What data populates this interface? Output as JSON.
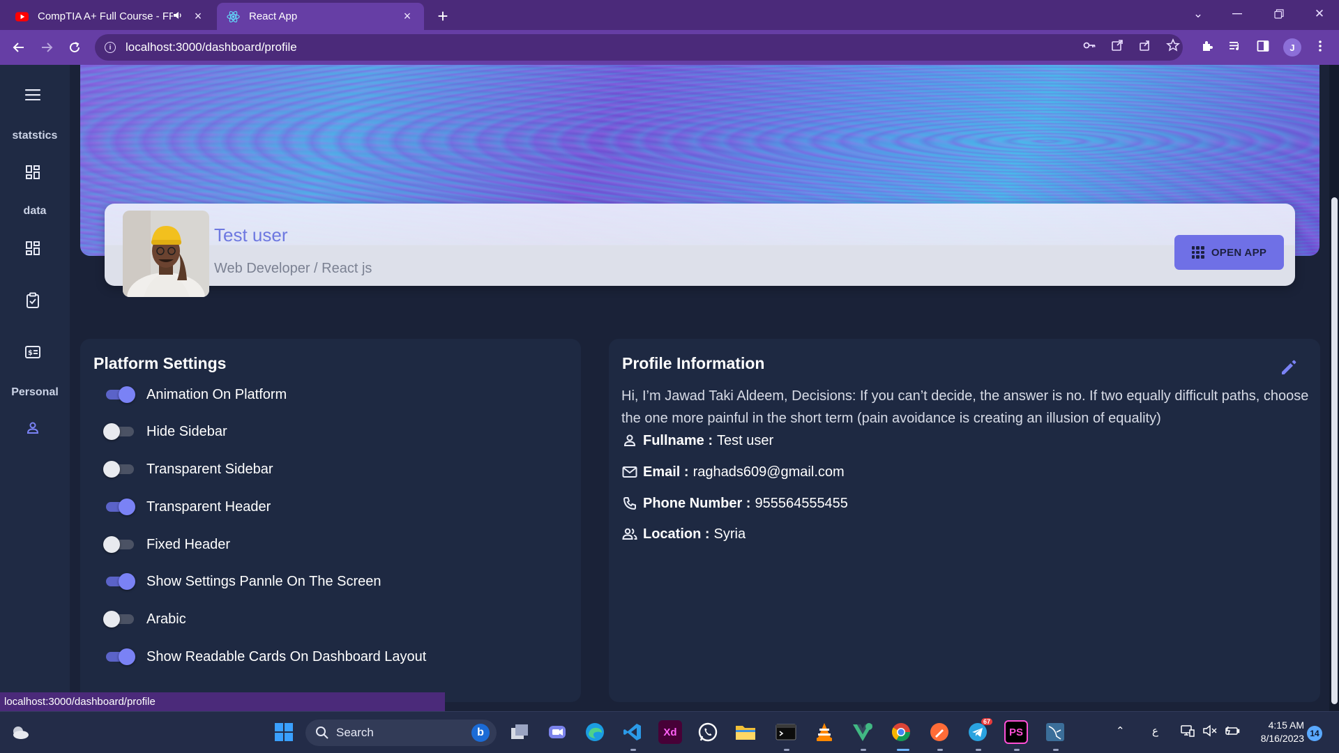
{
  "browser": {
    "tabs": [
      {
        "title": "CompTIA A+ Full Course - FR",
        "favicon": "youtube-icon",
        "active": false,
        "audio": true
      },
      {
        "title": "React App",
        "favicon": "react-icon",
        "active": true
      }
    ],
    "url": "localhost:3000/dashboard/profile",
    "profile_initial": "J",
    "status_url": "localhost:3000/dashboard/profile"
  },
  "sidebar": {
    "sections": [
      {
        "label": "statstics"
      },
      {
        "label": "data"
      },
      {
        "label": "Personal"
      }
    ]
  },
  "profile": {
    "name": "Test user",
    "role": "Web Developer / React js",
    "open_app_label": "OPEN APP"
  },
  "settings": {
    "title": "Platform Settings",
    "items": [
      {
        "label": "Animation On Platform",
        "on": true
      },
      {
        "label": "Hide Sidebar",
        "on": false
      },
      {
        "label": "Transparent Sidebar",
        "on": false
      },
      {
        "label": "Transparent Header",
        "on": true
      },
      {
        "label": "Fixed Header",
        "on": false
      },
      {
        "label": "Show Settings Pannle On The Screen",
        "on": true
      },
      {
        "label": "Arabic",
        "on": false
      },
      {
        "label": "Show Readable Cards On Dashboard Layout",
        "on": true
      }
    ]
  },
  "info": {
    "title": "Profile Information",
    "bio": "Hi, I’m Jawad Taki Aldeem, Decisions: If you can’t decide, the answer is no. If two equally difficult paths, choose the one more painful in the short term (pain avoidance is creating an illusion of equality)",
    "fields": [
      {
        "label": "Fullname :",
        "value": "Test user",
        "icon": "person-icon"
      },
      {
        "label": "Email :",
        "value": "raghads609@gmail.com",
        "icon": "mail-icon"
      },
      {
        "label": "Phone Number :",
        "value": "955564555455",
        "icon": "phone-icon"
      },
      {
        "label": "Location :",
        "value": "Syria",
        "icon": "group-icon"
      }
    ]
  },
  "taskbar": {
    "search_placeholder": "Search",
    "clock_time": "4:15 AM",
    "clock_date": "8/16/2023",
    "notification_count": "14",
    "ime_label": "ع",
    "telegram_badge": "67",
    "xd_label": "Xd",
    "ps_label": "PS"
  },
  "colors": {
    "accent": "#7a82f5",
    "chrome": "#663ea5",
    "page": "#1a2238",
    "card": "#1e2942"
  }
}
